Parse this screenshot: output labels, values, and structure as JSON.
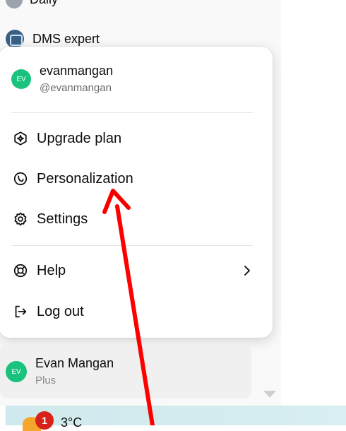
{
  "sidebar": {
    "partial_item_label": "Daily",
    "gpt_item_label": "DMS expert"
  },
  "menu": {
    "profile": {
      "initials": "EV",
      "name": "evanmangan",
      "handle": "@evanmangan"
    },
    "items": [
      {
        "label": "Upgrade plan",
        "icon": "upgrade-icon"
      },
      {
        "label": "Personalization",
        "icon": "personalization-icon"
      },
      {
        "label": "Settings",
        "icon": "gear-icon"
      },
      {
        "label": "Help",
        "icon": "help-lifebuoy-icon"
      },
      {
        "label": "Log out",
        "icon": "logout-icon"
      }
    ]
  },
  "account": {
    "initials": "EV",
    "name": "Evan Mangan",
    "plan": "Plus"
  },
  "taskbar": {
    "notification_count": "1",
    "temperature": "3°C"
  },
  "colors": {
    "avatar_green": "#19c37d",
    "annotation_arrow": "#ff0000",
    "notif_badge": "#d9211b"
  }
}
